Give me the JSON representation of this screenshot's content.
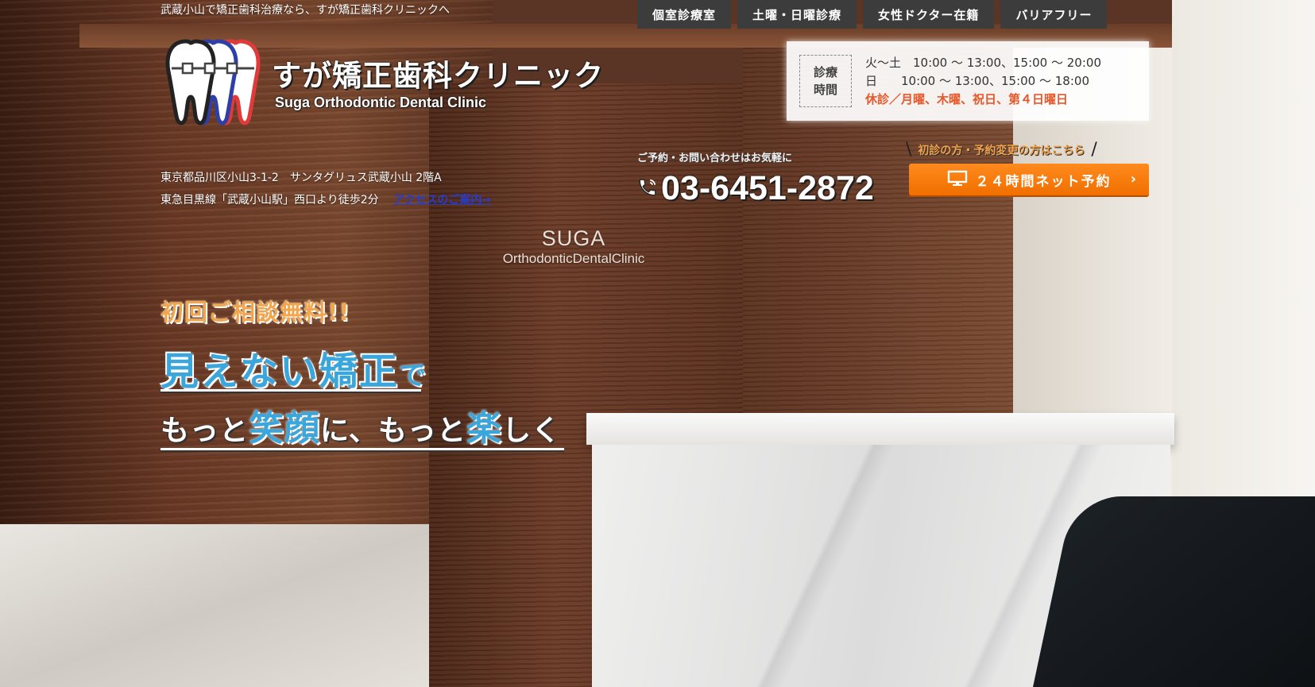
{
  "header": {
    "tagline": "武蔵小山で矯正歯科治療なら、すが矯正歯科クリニックへ",
    "badges": [
      "個室診療室",
      "土曜・日曜診療",
      "女性ドクター在籍",
      "バリアフリー"
    ]
  },
  "logo": {
    "name_jp": "すが矯正歯科クリニック",
    "name_en": "Suga Orthodontic Dental Clinic"
  },
  "hours": {
    "label_line1": "診療",
    "label_line2": "時間",
    "line1": "火～土　10:00 ～ 13:00、15:00 ～ 20:00",
    "line2": "日　　10:00 ～ 13:00、15:00 ～ 18:00",
    "closed": "休診／月曜、木曜、祝日、第４日曜日"
  },
  "address": {
    "line1": "東京都品川区小山3-1-2　サンタグリュス武蔵小山 2階A",
    "line2": "東急目黒線「武蔵小山駅」西口より徒歩2分",
    "access_link": "アクセスのご案内→"
  },
  "contact": {
    "note": "ご予約・お問い合わせはお気軽に",
    "phone": "03-6451-2872",
    "first_visit": "初診の方・予約変更の方はこちら",
    "reserve_label": "２４時間ネット予約"
  },
  "sign": {
    "line1": "SUGA",
    "line2": "OrthodonticDentalClinic"
  },
  "hero": {
    "sub": "初回ご相談無料!!",
    "line1_big": "見えない矯正",
    "line1_small": "で",
    "line2_a": "もっと",
    "line2_b": "笑顔",
    "line2_c": "に、もっと",
    "line2_d": "楽",
    "line2_e": "しく"
  },
  "colors": {
    "accent_orange": "#f06f00",
    "accent_blue": "#3aa6dc",
    "closed_red": "#e8572a",
    "badge_bg": "#3c3c3c"
  }
}
